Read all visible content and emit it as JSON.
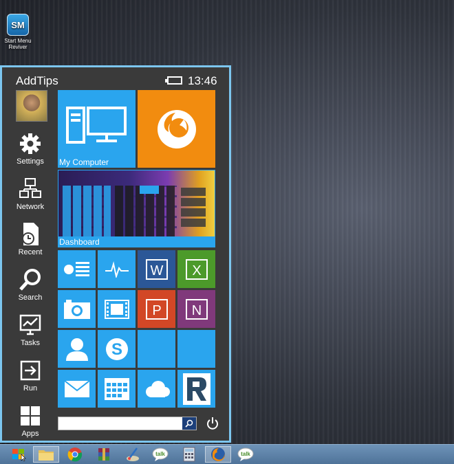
{
  "desktop": {
    "icon_label": "Start Menu Reviver",
    "icon_glyph": "SM"
  },
  "start_menu": {
    "title": "AddTips",
    "time": "13:46",
    "sidebar": [
      {
        "label": "Settings",
        "icon": "gear-icon"
      },
      {
        "label": "Network",
        "icon": "network-icon"
      },
      {
        "label": "Recent",
        "icon": "recent-icon"
      },
      {
        "label": "Search",
        "icon": "search-icon"
      },
      {
        "label": "Tasks",
        "icon": "tasks-icon"
      },
      {
        "label": "Run",
        "icon": "run-icon"
      },
      {
        "label": "Apps",
        "icon": "apps-icon"
      }
    ],
    "tiles": {
      "my_computer": "My Computer",
      "dashboard": "Dashboard"
    },
    "search": {
      "value": "",
      "placeholder": ""
    }
  },
  "colors": {
    "tile_blue": "#2aa5ee",
    "firefox_orange": "#f28c0f",
    "word_blue": "#2b5797",
    "excel_green": "#4c9a2a",
    "powerpoint_orange": "#d24726",
    "onenote_purple": "#80397b",
    "menu_border": "#7cc6ef"
  },
  "taskbar": {
    "items": [
      "start-icon",
      "file-explorer-icon",
      "chrome-icon",
      "winrar-icon",
      "paint-icon",
      "talk-icon",
      "calculator-icon",
      "firefox-icon",
      "talk-icon"
    ]
  }
}
